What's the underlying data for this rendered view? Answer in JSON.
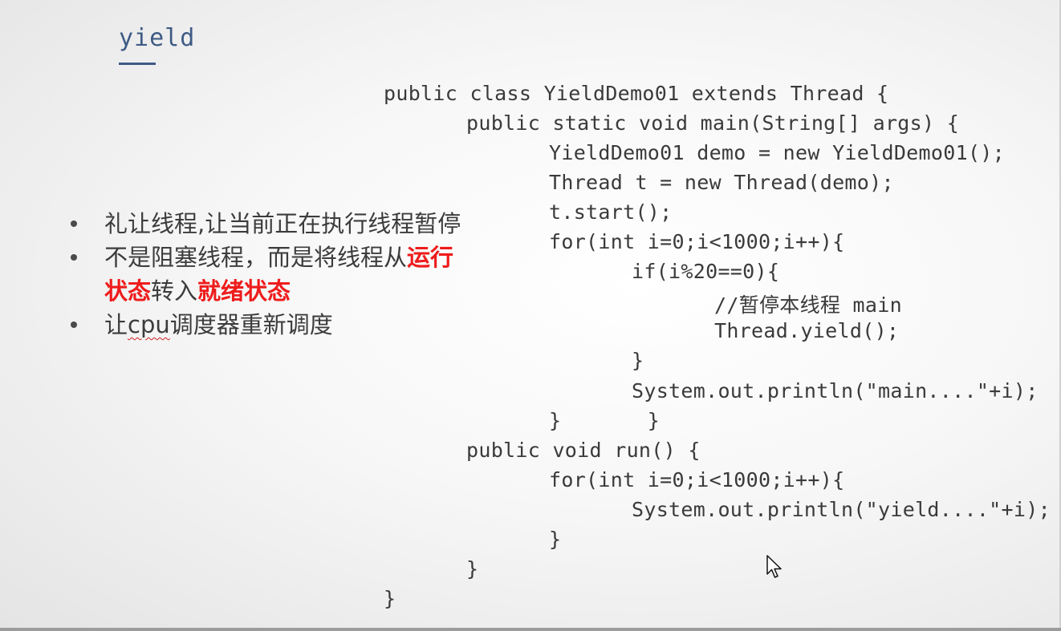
{
  "slide": {
    "title": "yield",
    "bullets": [
      {
        "segments": [
          {
            "text": "礼让线程,让当前正在执行线程暂停",
            "style": "normal"
          }
        ]
      },
      {
        "segments": [
          {
            "text": "不是阻塞线程，而是将线程从",
            "style": "normal"
          },
          {
            "text": "运行",
            "style": "red"
          }
        ]
      },
      {
        "segments": [
          {
            "text": "状态",
            "style": "red"
          },
          {
            "text": "转入",
            "style": "normal"
          },
          {
            "text": "就绪状态",
            "style": "red"
          }
        ],
        "continuation": true
      },
      {
        "segments": [
          {
            "text": "让",
            "style": "normal"
          },
          {
            "text": "cpu",
            "style": "squiggle"
          },
          {
            "text": "调度器重新调度",
            "style": "normal"
          }
        ]
      }
    ],
    "code_lines": [
      "public class YieldDemo01 extends Thread {",
      "public static void main(String[] args) {",
      "YieldDemo01 demo = new YieldDemo01();",
      "Thread t = new Thread(demo);",
      "t.start();",
      "for(int i=0;i<1000;i++){",
      "if(i%20==0){",
      "//暂停本线程 main",
      "Thread.yield();",
      "}",
      "System.out.println(\"main....\"+i);",
      "}       }",
      "public void run() {",
      "for(int i=0;i<1000;i++){",
      "System.out.println(\"yield....\"+i);",
      "}",
      "}",
      "}"
    ],
    "cursor_icon": "mouse-pointer-icon"
  }
}
